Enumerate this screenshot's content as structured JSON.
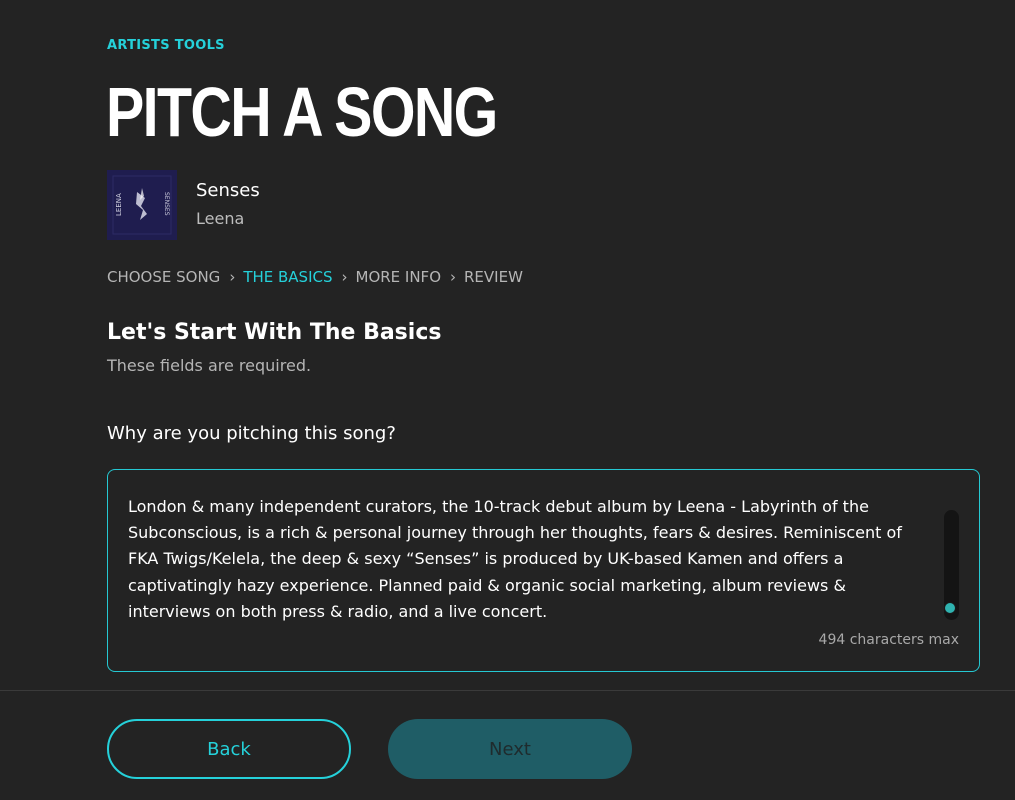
{
  "header": {
    "eyebrow": "ARTISTS TOOLS",
    "title": "PITCH A SONG"
  },
  "song": {
    "title": "Senses",
    "artist": "Leena",
    "album_art_icon": "album-art"
  },
  "steps": [
    {
      "label": "CHOOSE SONG",
      "active": false
    },
    {
      "label": "THE BASICS",
      "active": true
    },
    {
      "label": "MORE INFO",
      "active": false
    },
    {
      "label": "REVIEW",
      "active": false
    }
  ],
  "section": {
    "title": "Let's Start With The Basics",
    "subtitle": "These fields are required."
  },
  "form": {
    "question": "Why are you pitching this song?",
    "answer": "London & many independent curators, the 10-track debut album by Leena - Labyrinth of the Subconscious, is a rich & personal journey through her thoughts, fears & desires. Reminiscent of FKA Twigs/Kelela, the deep & sexy “Senses” is produced by UK-based Kamen and offers a captivatingly hazy experience. Planned paid & organic social marketing, album reviews & interviews on both press & radio, and a live concert.",
    "counter": "494 characters max"
  },
  "buttons": {
    "back": "Back",
    "next": "Next"
  },
  "colors": {
    "background": "#232323",
    "accent": "#25d1da",
    "next_button_bg": "#1f5d66"
  }
}
